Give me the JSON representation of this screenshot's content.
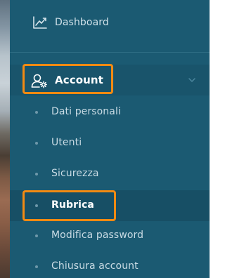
{
  "colors": {
    "sidebar_bg": "#1b5a72",
    "highlight": "#f28a12",
    "text": "#d7e5ec",
    "active_text": "#ffffff"
  },
  "nav": {
    "dashboard": {
      "label": "Dashboard",
      "icon": "chart-line-icon"
    },
    "account": {
      "label": "Account",
      "icon": "user-gear-icon",
      "expanded": true
    },
    "account_items": [
      {
        "label": "Dati personali"
      },
      {
        "label": "Utenti"
      },
      {
        "label": "Sicurezza"
      },
      {
        "label": "Rubrica",
        "active": true
      },
      {
        "label": "Modifica password"
      },
      {
        "label": "Chiusura account"
      }
    ]
  }
}
